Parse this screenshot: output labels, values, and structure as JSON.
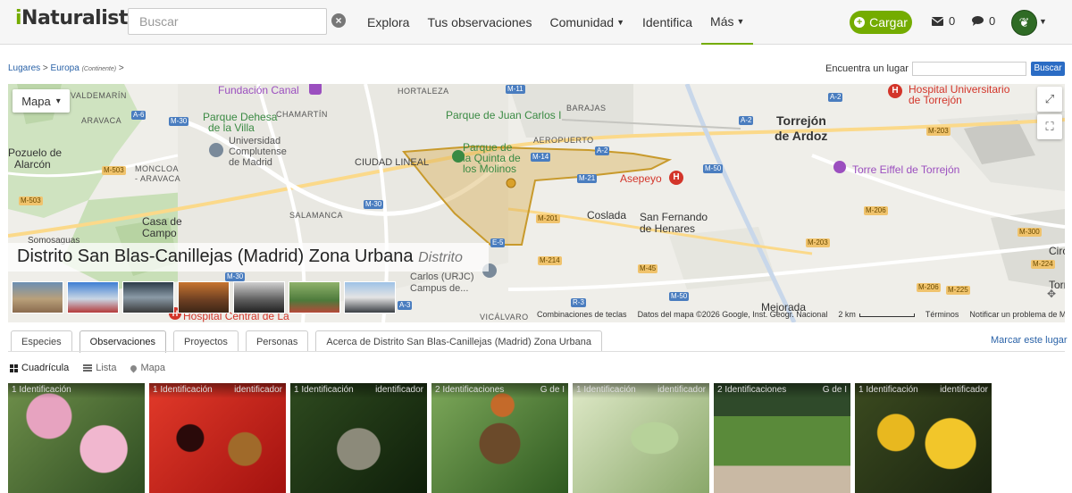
{
  "header": {
    "logo_i": "i",
    "logo_rest": "Naturalist",
    "search_placeholder": "Buscar",
    "clear_icon": "×",
    "nav": [
      {
        "label": "Explora",
        "has_caret": false
      },
      {
        "label": "Tus observaciones",
        "has_caret": false
      },
      {
        "label": "Comunidad",
        "has_caret": true
      },
      {
        "label": "Identifica",
        "has_caret": false
      },
      {
        "label": "Más",
        "has_caret": true
      }
    ],
    "upload_label": "Cargar",
    "messages_count": "0",
    "notifications_count": "0",
    "avatar_icon": "leaf-icon",
    "accent_color": "#74ac00"
  },
  "breadcrumb": {
    "places": "Lugares",
    "sep1": ">",
    "europe": "Europa",
    "europe_sub": "(Continente)",
    "sep2": ">"
  },
  "place_search": {
    "label": "Encuentra un lugar",
    "value": "",
    "button": "Buscar"
  },
  "map": {
    "type_label": "Mapa",
    "type_caret": "▾",
    "fullscreen_icon": "⛶",
    "expand_icon": "⤢",
    "place_name": "Distrito San Blas-Canillejas (Madrid) Zona Urbana",
    "place_kind": "Distrito",
    "labels": {
      "hortaleza": "HORTALEZA",
      "barajas": "BARAJAS",
      "chamartin": "CHAMARTÍN",
      "aeropuerto": "AEROPUERTO",
      "aravaca": "ARAVACA",
      "valdemarin": "VALDEMARÍN",
      "ciudad_lineal": "CIUDAD LINEAL",
      "salamanca": "SALAMANCA",
      "moncloa": "MONCLOA",
      "moncloa2": "- ARAVACA",
      "vicalvaro": "VICÁLVARO",
      "pozuelo1": "Pozuelo de",
      "pozuelo2": "Alarcón",
      "casa1": "Casa de",
      "casa2": "Campo",
      "somosaguas": "Somosaguas",
      "torrejon1": "Torrejón",
      "torrejon2": "de Ardoz",
      "coslada": "Coslada",
      "sanfer1": "San Fernando",
      "sanfer2": "de Henares",
      "mejorada": "Mejorada",
      "fundacion": "Fundación Canal",
      "parque_dehesa1": "Parque Dehesa",
      "parque_dehesa2": "de la Villa",
      "ucm1": "Universidad",
      "ucm2": "Complutense",
      "ucm3": "de Madrid",
      "parque_jc": "Parque de Juan Carlos I",
      "parque_quinta1": "Parque de",
      "parque_quinta2": "la Quinta de",
      "parque_quinta3": "los Molinos",
      "asepeyo": "Asepeyo",
      "hospital_torrejon1": "Hospital Universitario",
      "hospital_torrejon2": "de Torrejón",
      "torre_eiffel": "Torre Eiffel de Torrejón",
      "carlos1": "Carlos (URJC)",
      "carlos2": "Campus de...",
      "hospital_central": "Hospital Central de La",
      "circ": "Circ",
      "torre": "Torre"
    },
    "roads": {
      "m11": "M-11",
      "a6": "A-6",
      "m30a": "M-30",
      "m30b": "M-30",
      "m30c": "M-30",
      "m40": "M-40",
      "m503a": "M-503",
      "m503b": "M-503",
      "m14": "M-14",
      "m21": "M-21",
      "m50a": "M-50",
      "m50b": "M-50",
      "m201": "M-201",
      "m214": "M-214",
      "m45": "M-45",
      "m203a": "M-203",
      "m203b": "M-203",
      "m206a": "M-206",
      "m206b": "M-206",
      "m300": "M-300",
      "m224": "M-224",
      "m225": "M-225",
      "a2a": "A-2",
      "a2b": "A-2",
      "a2c": "A-2",
      "a3": "A-3",
      "r3": "R-3",
      "e5": "E-5"
    },
    "footer": {
      "shortcuts": "Combinaciones de teclas",
      "data": "Datos del mapa ©2026 Google, Inst. Geogr. Nacional",
      "scale": "2 km",
      "terms": "Términos",
      "report": "Notificar un problema de Maps"
    },
    "thumbnail_count": 7
  },
  "tabs": [
    {
      "label": "Especies",
      "active": false
    },
    {
      "label": "Observaciones",
      "active": true
    },
    {
      "label": "Proyectos",
      "active": false
    },
    {
      "label": "Personas",
      "active": false
    },
    {
      "label": "Acerca de Distrito San Blas-Canillejas (Madrid) Zona Urbana",
      "active": false
    }
  ],
  "mark_favorite": "Marcar este lugar",
  "view_modes": {
    "grid": "Cuadrícula",
    "list": "Lista",
    "map": "Mapa"
  },
  "observations": [
    {
      "ids": "1 Identificación",
      "right": ""
    },
    {
      "ids": "1 Identificación",
      "right": "identificador"
    },
    {
      "ids": "1 Identificación",
      "right": "identificador"
    },
    {
      "ids": "2 Identificaciones",
      "right": "G de I"
    },
    {
      "ids": "1 Identificación",
      "right": "identificador"
    },
    {
      "ids": "2 Identificaciones",
      "right": "G de I"
    },
    {
      "ids": "1 Identificación",
      "right": "identificador"
    }
  ]
}
